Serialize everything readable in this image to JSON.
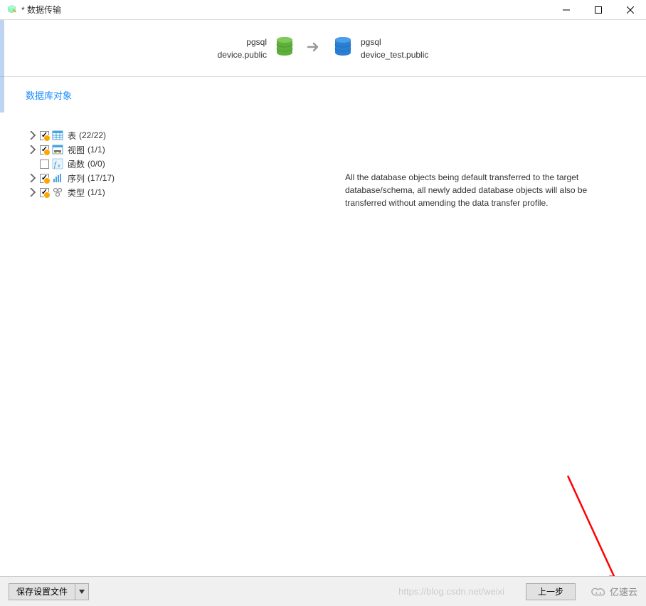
{
  "window": {
    "title": "* 数据传输"
  },
  "source": {
    "name": "pgsql",
    "schema": "device.public"
  },
  "target": {
    "name": "pgsql",
    "schema": "device_test.public"
  },
  "section_title": "数据库对象",
  "tree": [
    {
      "expandable": true,
      "checked": true,
      "warn": true,
      "icon": "table",
      "label": "表",
      "count": "(22/22)"
    },
    {
      "expandable": true,
      "checked": true,
      "warn": true,
      "icon": "view",
      "label": "视图",
      "count": "(1/1)"
    },
    {
      "expandable": false,
      "checked": false,
      "warn": false,
      "icon": "function",
      "label": "函数",
      "count": "(0/0)"
    },
    {
      "expandable": true,
      "checked": true,
      "warn": true,
      "icon": "sequence",
      "label": "序列",
      "count": "(17/17)"
    },
    {
      "expandable": true,
      "checked": true,
      "warn": true,
      "icon": "type",
      "label": "类型",
      "count": "(1/1)"
    }
  ],
  "description_text": "All the database objects being default transferred to the target database/schema, all newly added database objects will also be transferred without amending the data transfer profile.",
  "footer": {
    "save_profile": "保存设置文件",
    "prev_button": "上一步",
    "watermark": "https://blog.csdn.net/weixi",
    "brand": "亿速云"
  }
}
